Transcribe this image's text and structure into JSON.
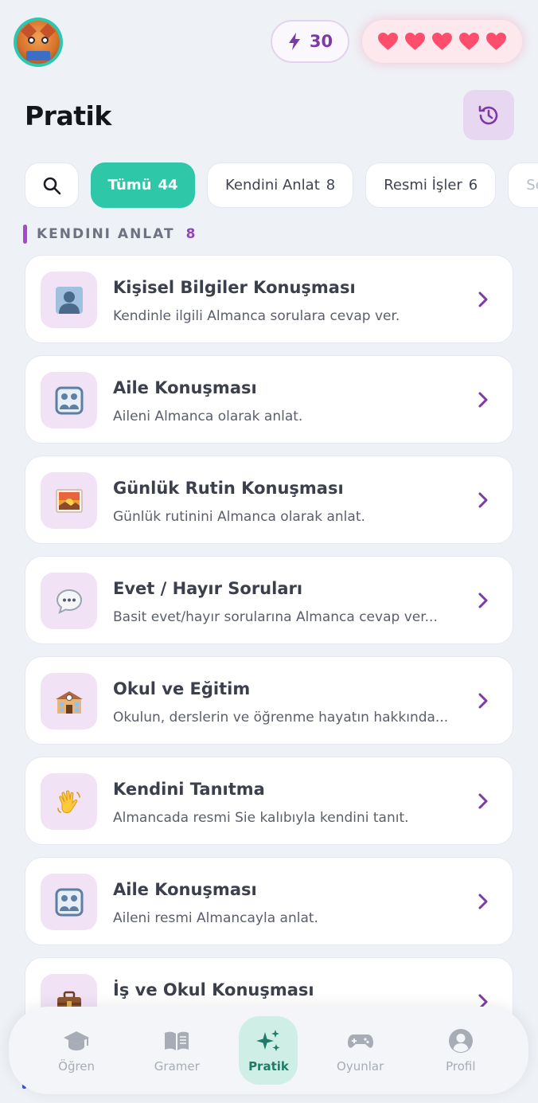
{
  "header": {
    "avatar_icon": "fox-reading-avatar",
    "streak_icon": "lightning-bolt-icon",
    "streak_count": "30",
    "hearts_count": 5,
    "hearts_icon": "heart-icon",
    "title": "Pratik",
    "history_icon": "history-clock-icon"
  },
  "filters": {
    "search_icon": "search-icon",
    "chips": [
      {
        "label": "Tümü",
        "count": "44",
        "active": true
      },
      {
        "label": "Kendini Anlat",
        "count": "8",
        "active": false
      },
      {
        "label": "Resmi İşler",
        "count": "6",
        "active": false
      },
      {
        "label": "Se",
        "count": "",
        "active": false
      }
    ]
  },
  "section": {
    "title": "KENDINI ANLAT",
    "count": "8",
    "accent_color": "#a24dc7"
  },
  "cards": [
    {
      "icon": "person-silhouette-icon",
      "title": "Kişisel Bilgiler Konuşması",
      "subtitle": "Kendinle ilgili Almanca sorulara cevap ver."
    },
    {
      "icon": "family-icon",
      "title": "Aile Konuşması",
      "subtitle": "Aileni Almanca olarak anlat."
    },
    {
      "icon": "sunrise-icon",
      "title": "Günlük Rutin Konuşması",
      "subtitle": "Günlük rutinini Almanca olarak anlat."
    },
    {
      "icon": "speech-bubble-icon",
      "title": "Evet / Hayır Soruları",
      "subtitle": "Basit evet/hayır sorularına Almanca cevap ver..."
    },
    {
      "icon": "school-icon",
      "title": "Okul ve Eğitim",
      "subtitle": "Okulun, derslerin ve öğrenme hayatın hakkında..."
    },
    {
      "icon": "waving-hand-icon",
      "title": "Kendini Tanıtma",
      "subtitle": "Almancada resmi Sie kalıbıyla kendini tanıt."
    },
    {
      "icon": "family-icon",
      "title": "Aile Konuşması",
      "subtitle": "Aileni resmi Almancayla anlat."
    },
    {
      "icon": "briefcase-icon",
      "title": "İş ve Okul Konuşması",
      "subtitle": ""
    }
  ],
  "nav": [
    {
      "label": "Öğren",
      "icon": "graduation-cap-icon",
      "active": false
    },
    {
      "label": "Gramer",
      "icon": "open-book-icon",
      "active": false
    },
    {
      "label": "Pratik",
      "icon": "sparkles-icon",
      "active": true
    },
    {
      "label": "Oyunlar",
      "icon": "gamepad-icon",
      "active": false
    },
    {
      "label": "Profil",
      "icon": "user-circle-icon",
      "active": false
    }
  ],
  "colors": {
    "accent_teal": "#2ec7a8",
    "accent_purple": "#7c3aa8",
    "heart_red": "#ff4d6d",
    "icon_tile_bg": "#f1e2f6"
  }
}
